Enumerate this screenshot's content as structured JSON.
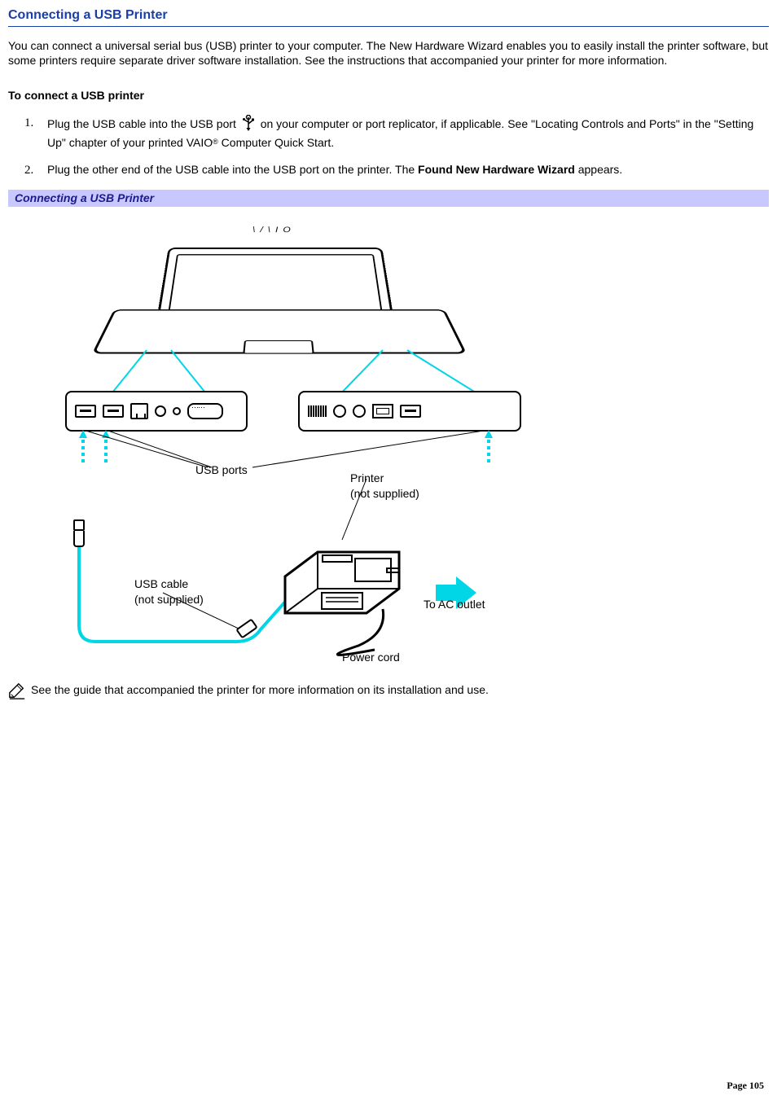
{
  "title": "Connecting a USB Printer",
  "intro": "You can connect a universal serial bus (USB) printer to your computer. The New Hardware Wizard enables you to easily install the printer software, but some printers require separate driver software installation. See the instructions that accompanied your printer for more information.",
  "section_heading": "To connect a USB printer",
  "steps": {
    "s1_num": "1.",
    "s1_a": "Plug the USB cable into the USB port ",
    "s1_b": " on your computer or port replicator, if applicable. See \"Locating Controls and Ports\" in the \"Setting Up\" chapter of your printed VAIO",
    "s1_c": " Computer Quick Start.",
    "s1_reg": "®",
    "s2_num": "2.",
    "s2_a": "Plug the other end of the USB cable into the USB port on the printer. The ",
    "s2_bold": "Found New Hardware Wizard",
    "s2_b": " appears."
  },
  "figure": {
    "caption": "Connecting a USB Printer",
    "logo": "\\/\\IO",
    "label_usb_ports": "USB ports",
    "label_printer_l1": "Printer",
    "label_printer_l2": "(not supplied)",
    "label_usb_cable_l1": "USB cable",
    "label_usb_cable_l2": "(not supplied)",
    "label_ac": "To AC outlet",
    "label_power_cord": "Power cord"
  },
  "note": "See the guide that accompanied the printer for more information on its installation and use.",
  "page_label": "Page 105"
}
